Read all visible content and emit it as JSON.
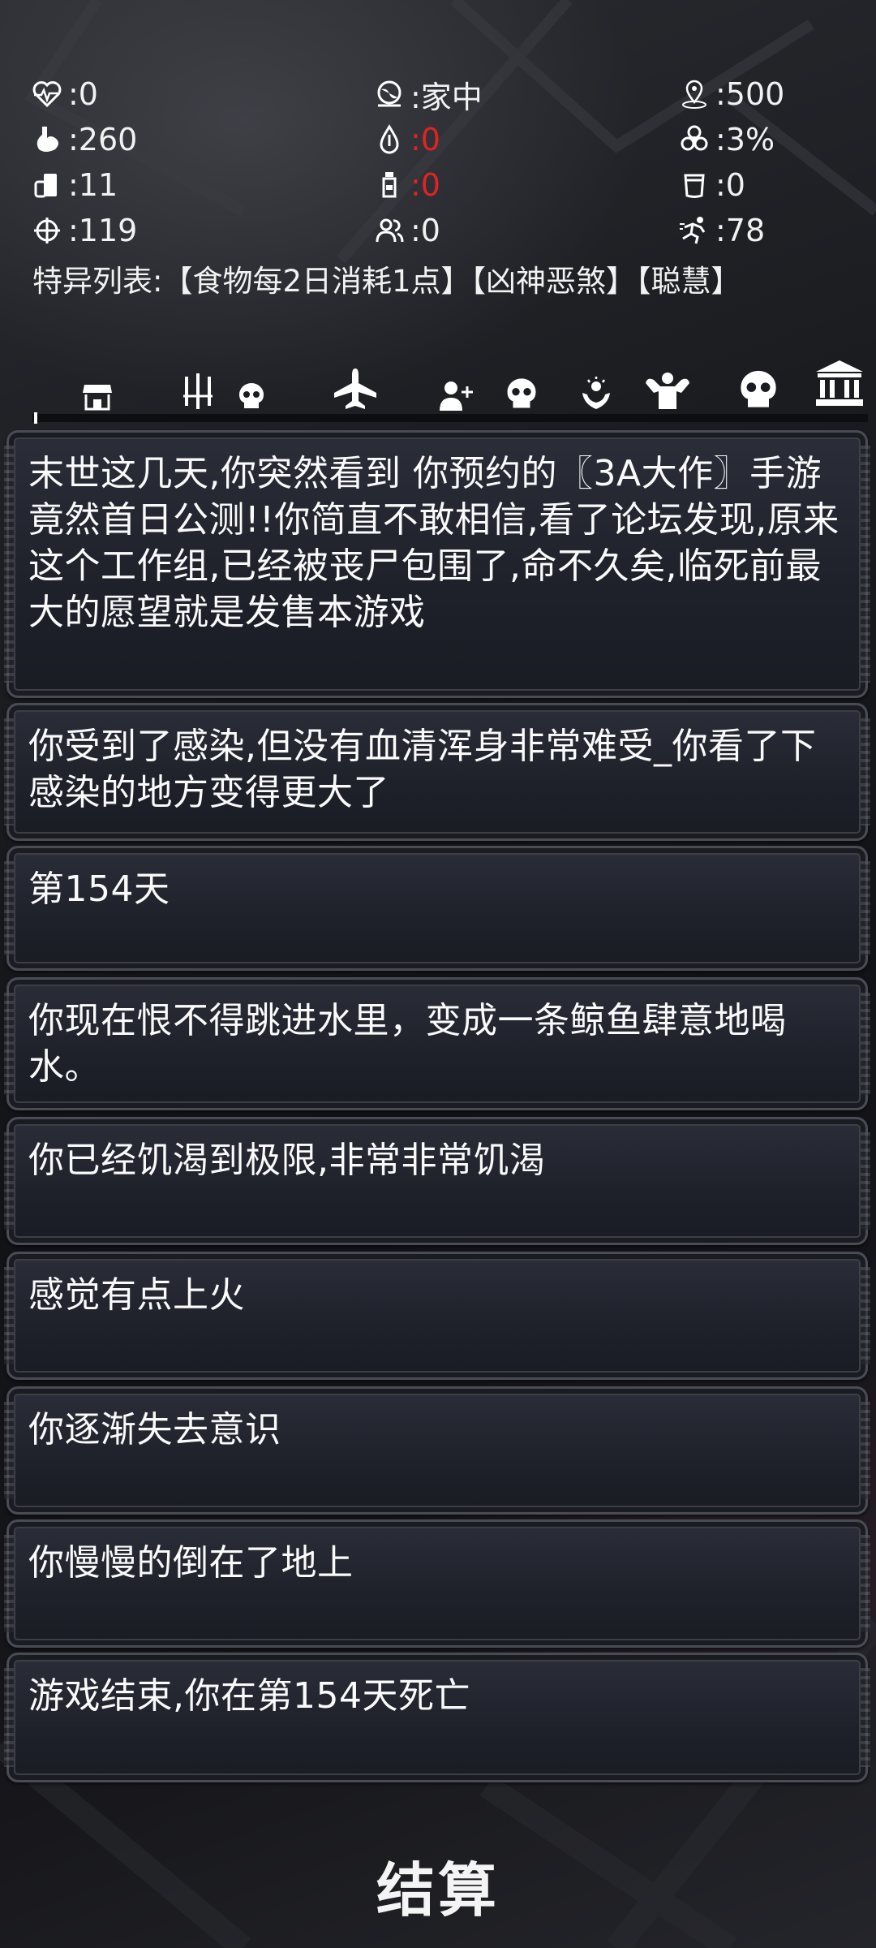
{
  "stats": {
    "health": {
      "icon": "heartbeat-icon",
      "value": ":0"
    },
    "location": {
      "icon": "globe-location-icon",
      "value": ":家中"
    },
    "distance": {
      "icon": "map-pin-icon",
      "value": ":500"
    },
    "food": {
      "icon": "stomach-icon",
      "value": ":260"
    },
    "water": {
      "icon": "water-drop-icon",
      "value": ":0"
    },
    "infection": {
      "icon": "biohazard-icon",
      "value": ":3%"
    },
    "supplies": {
      "icon": "canned-food-icon",
      "value": ":11"
    },
    "serum": {
      "icon": "bottle-icon",
      "value": ":0"
    },
    "ammo": {
      "icon": "cup-icon",
      "value": ":0"
    },
    "aim": {
      "icon": "crosshair-icon",
      "value": ":119"
    },
    "companions": {
      "icon": "people-icon",
      "value": ":0"
    },
    "agility": {
      "icon": "running-icon",
      "value": ":78"
    }
  },
  "traits": "特异列表:【食物每2日消耗1点】【凶神恶煞】【聪慧】",
  "nav": [
    {
      "icon": "shop-icon"
    },
    {
      "icon": "weapons-icon"
    },
    {
      "icon": "skull-small-icon"
    },
    {
      "icon": "airplane-icon"
    },
    {
      "icon": "add-user-icon"
    },
    {
      "icon": "skull-icon"
    },
    {
      "icon": "hands-light-icon"
    },
    {
      "icon": "muscle-icon"
    },
    {
      "icon": "skull-large-icon"
    },
    {
      "icon": "bank-icon"
    }
  ],
  "events": [
    "末世这几天,你突然看到 你预约的〖3A大作〗手游竟然首日公测!!你简直不敢相信,看了论坛发现,原来这个工作组,已经被丧尸包围了,命不久矣,临死前最大的愿望就是发售本游戏",
    "你受到了感染,但没有血清浑身非常难受_你看了下感染的地方变得更大了",
    "第154天",
    "你现在恨不得跳进水里，变成一条鲸鱼肆意地喝水。",
    "你已经饥渴到极限,非常非常饥渴",
    "感觉有点上火",
    "你逐渐失去意识",
    "你慢慢的倒在了地上",
    "游戏结束,你在第154天死亡"
  ],
  "settle_button": "结算",
  "colors": {
    "warning": "#e02323",
    "text": "#f2f2f2",
    "card": "#22242e"
  }
}
